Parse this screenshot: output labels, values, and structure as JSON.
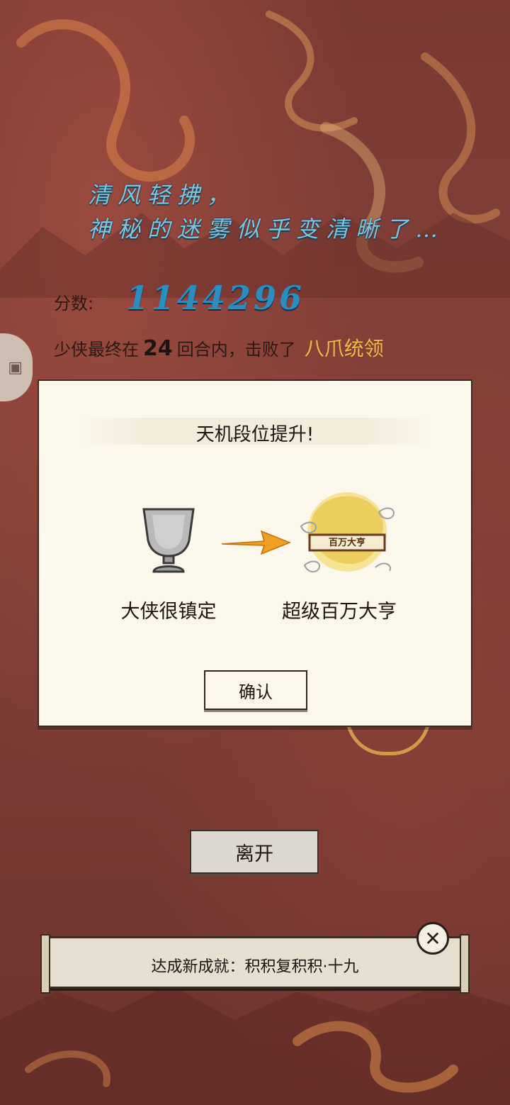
{
  "header": {
    "line1": "清风轻拂，",
    "line2": "神秘的迷雾似乎变清晰了…"
  },
  "score": {
    "label": "分数:",
    "value": "1144296"
  },
  "battle": {
    "prefix": "少侠最终在",
    "rounds": "24",
    "middle": "回合内，击败了",
    "boss": "八爪统领"
  },
  "modal": {
    "title": "天机段位提升!",
    "old_rank": "大侠很镇定",
    "new_rank": "超级百万大亨",
    "badge_text": "百万大亨",
    "confirm_label": "确认"
  },
  "leave_label": "离开",
  "achievement": {
    "text": "达成新成就：积积复积积·十九"
  },
  "colors": {
    "title_text": "#7fc4dc",
    "score_value": "#2b8ec0",
    "boss_name": "#f2b94b",
    "background": "#7a3a33"
  }
}
